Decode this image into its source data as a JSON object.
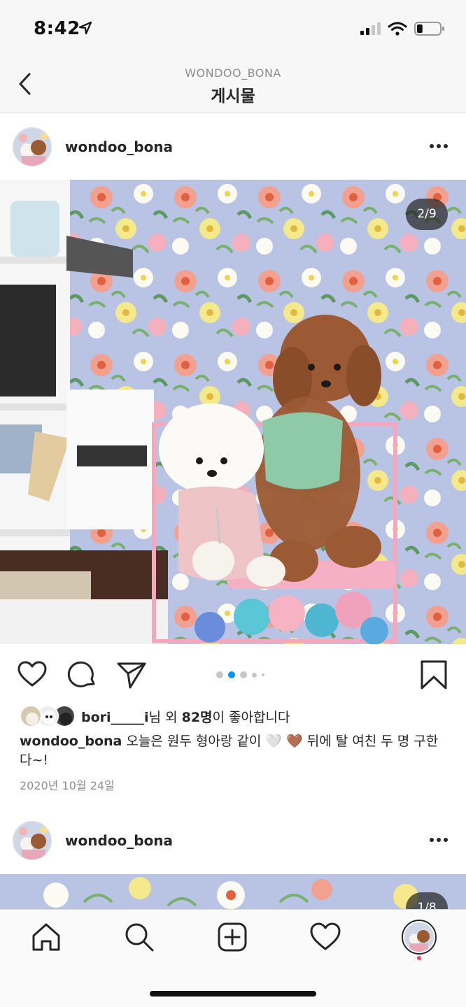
{
  "status_bar": {
    "time": "8:42",
    "battery_level": 0.25
  },
  "nav": {
    "account": "WONDOO_BONA",
    "title": "게시물"
  },
  "post": {
    "username": "wondoo_bona",
    "photo_counter": "2/9",
    "carousel": {
      "total_dots": 5,
      "active_index": 1
    },
    "likes": {
      "user": "bori_____i",
      "suffix_1": "님 외 ",
      "count": "82명",
      "suffix_2": "이 좋아합니다"
    },
    "caption": {
      "username": "wondoo_bona",
      "text": "오늘은 원두 형아랑 같이 🤍 🤎 뒤에 탈 여친 두 명 구한다~!"
    },
    "date": "2020년 10월 24일"
  },
  "next_post": {
    "username": "wondoo_bona",
    "photo_counter": "1/8"
  },
  "tabbar": {
    "icons": [
      "home-icon",
      "search-icon",
      "new-post-icon",
      "activity-heart-icon",
      "profile-avatar"
    ]
  },
  "colors": {
    "accent_blue": "#0095f6",
    "text": "#262626",
    "muted": "#8e8e8e",
    "notification": "#ed4956"
  }
}
